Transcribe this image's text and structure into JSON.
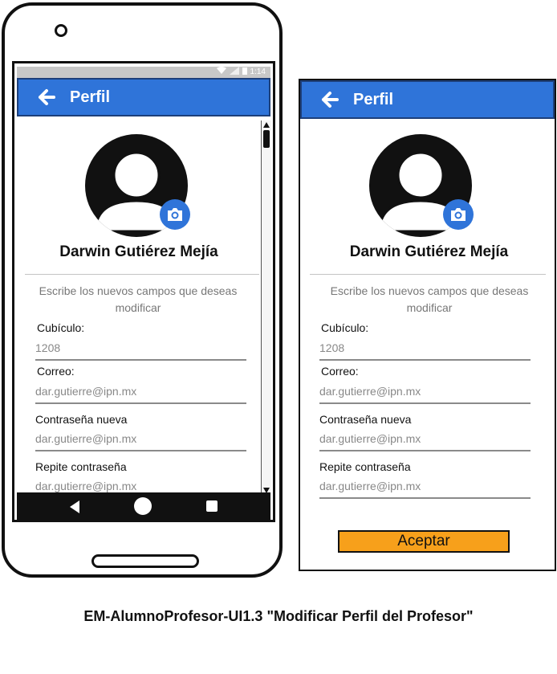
{
  "status_bar": {
    "time": "1:14"
  },
  "screen": {
    "title": "Perfil",
    "user_name": "Darwin Gutiérez Mejía",
    "instructions": "Escribe los nuevos campos que deseas modificar",
    "fields": [
      {
        "label": "Cubículo:",
        "value": "1208"
      },
      {
        "label": "Correo:",
        "value": "dar.gutierre@ipn.mx"
      },
      {
        "label": "Contraseña nueva",
        "value": "dar.gutierre@ipn.mx"
      },
      {
        "label": "Repite contraseña",
        "value": "dar.gutierre@ipn.mx"
      }
    ],
    "accept_label": "Aceptar"
  },
  "caption": "EM-AlumnoProfesor-UI1.3 \"Modificar Perfil del Profesor\"",
  "colors": {
    "accent": "#2f74d9",
    "button": "#f7a01b"
  }
}
